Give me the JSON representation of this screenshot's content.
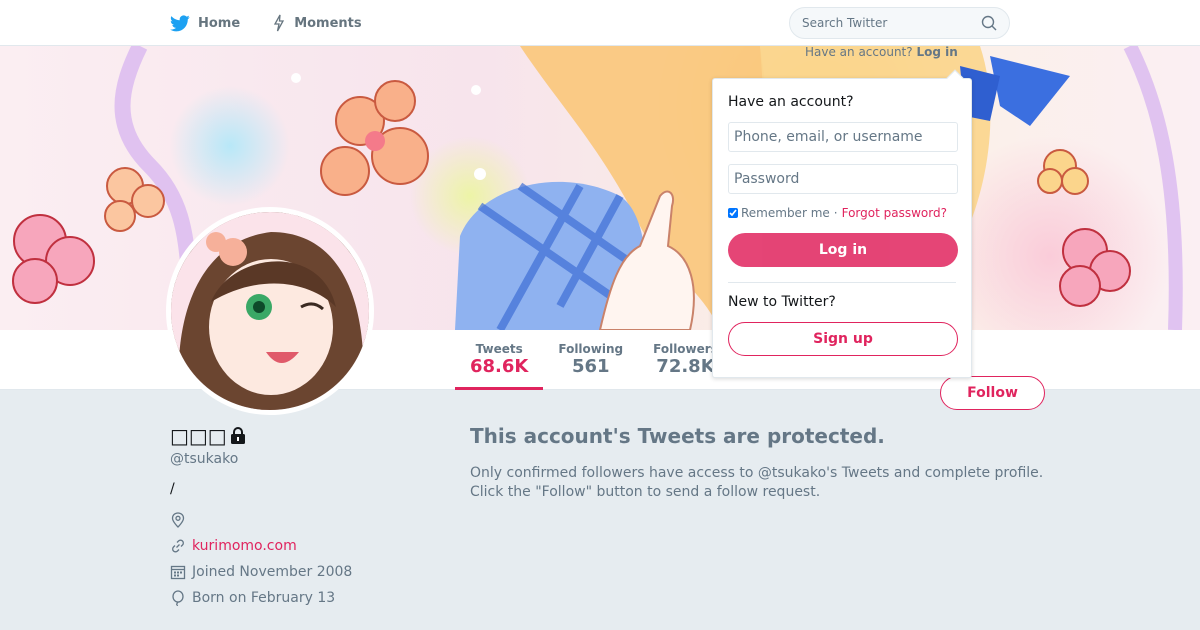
{
  "colors": {
    "accent": "#e0245e",
    "twitter_blue": "#1da1f2",
    "secondary_text": "#657786",
    "page_background": "#e6ecf0"
  },
  "nav": {
    "home_label": "Home",
    "moments_label": "Moments"
  },
  "search": {
    "placeholder": "Search Twitter"
  },
  "signin_hint": {
    "text": "Have an account?",
    "link": "Log in"
  },
  "login": {
    "heading": "Have an account?",
    "username_placeholder": "Phone, email, or username",
    "password_placeholder": "Password",
    "remember_label": "Remember me",
    "separator": "·",
    "forgot_link": "Forgot password?",
    "login_button": "Log in",
    "new_to_label": "New to Twitter?",
    "signup_button": "Sign up"
  },
  "stats": [
    {
      "label": "Tweets",
      "value": "68.6K"
    },
    {
      "label": "Following",
      "value": "561"
    },
    {
      "label": "Followers",
      "value": "72.8K"
    }
  ],
  "follow_button": "Follow",
  "profile": {
    "name": "□□□",
    "handle": "@tsukako",
    "bio": "/",
    "website": "kurimomo.com",
    "joined": "Joined November 2008",
    "born": "Born on February 13"
  },
  "protected": {
    "heading": "This account's Tweets are protected.",
    "line1": "Only confirmed followers have access to @tsukako's Tweets and complete profile.",
    "line2": "Click the \"Follow\" button to send a follow request."
  }
}
